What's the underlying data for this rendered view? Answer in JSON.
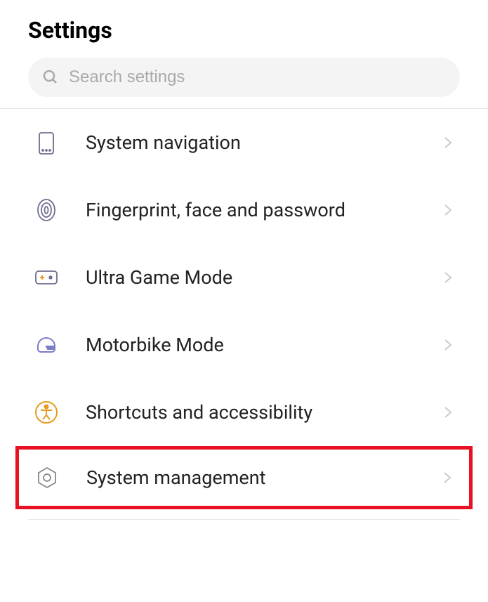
{
  "header": {
    "title": "Settings"
  },
  "search": {
    "placeholder": "Search settings"
  },
  "items": [
    {
      "label": "System navigation",
      "icon": "phone"
    },
    {
      "label": "Fingerprint, face and password",
      "icon": "fingerprint"
    },
    {
      "label": "Ultra Game Mode",
      "icon": "gamepad"
    },
    {
      "label": "Motorbike Mode",
      "icon": "helmet"
    },
    {
      "label": "Shortcuts and accessibility",
      "icon": "accessibility"
    },
    {
      "label": "System management",
      "icon": "gear-hex",
      "highlighted": true
    }
  ]
}
